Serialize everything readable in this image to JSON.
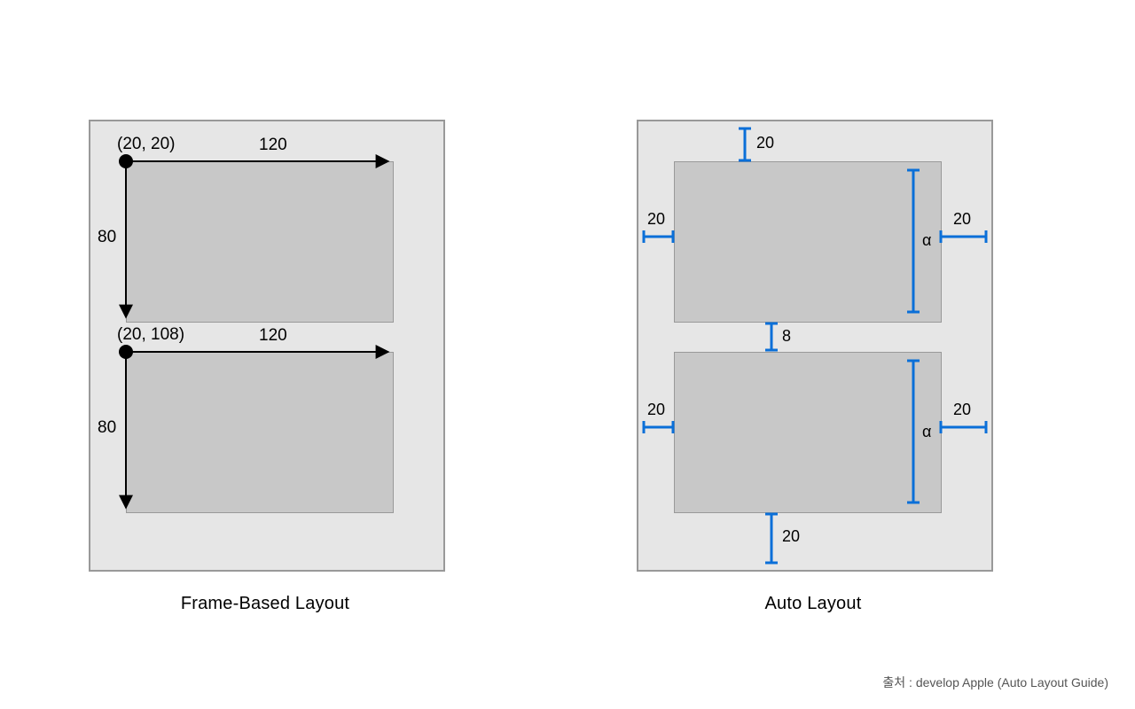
{
  "left": {
    "caption": "Frame-Based Layout",
    "box1": {
      "origin_label": "(20, 20)",
      "width_label": "120",
      "height_label": "80"
    },
    "box2": {
      "origin_label": "(20, 108)",
      "width_label": "120",
      "height_label": "80"
    }
  },
  "right": {
    "caption": "Auto Layout",
    "top_margin": "20",
    "bottom_margin": "20",
    "gap": "8",
    "row1": {
      "leading": "20",
      "trailing": "20",
      "height": "α"
    },
    "row2": {
      "leading": "20",
      "trailing": "20",
      "height": "α"
    }
  },
  "credit": "출처 :  develop Apple (Auto Layout Guide)",
  "colors": {
    "constraint_blue": "#0a6fd8"
  }
}
